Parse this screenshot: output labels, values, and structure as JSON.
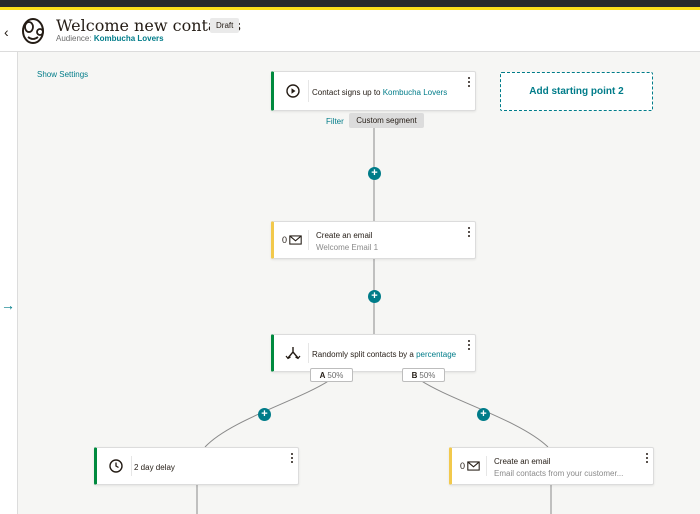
{
  "header": {
    "back_label": "‹",
    "title": "Welcome new contacts",
    "status_badge": "Draft",
    "audience_prefix": "Audience:",
    "audience_name": "Kombucha Lovers"
  },
  "sidebar": {
    "show_settings": "Show Settings",
    "expand_icon": "arrow-right-icon",
    "expand_glyph": "→"
  },
  "journey": {
    "trigger": {
      "icon": "play-icon",
      "text_prefix": "Contact signs up to",
      "text_link": "Kombucha Lovers"
    },
    "add_starting_point": "Add starting point 2",
    "filter_label": "Filter",
    "segment_label": "Custom segment",
    "email_step_1": {
      "icon": "envelope-icon",
      "count": "0",
      "title": "Create an email",
      "subtitle": "Welcome Email 1"
    },
    "split_step": {
      "icon": "split-icon",
      "text_prefix": "Randomly split contacts by a",
      "text_link": "percentage"
    },
    "branch_a": {
      "letter": "A",
      "percent": "50%"
    },
    "branch_b": {
      "letter": "B",
      "percent": "50%"
    },
    "delay_step": {
      "icon": "clock-icon",
      "title": "2 day delay"
    },
    "email_step_2": {
      "icon": "envelope-icon",
      "count": "0",
      "title": "Create an email",
      "subtitle": "Email contacts from your customer..."
    },
    "add_step_glyph": "+"
  },
  "colors": {
    "brand_teal": "#007c89",
    "status_green": "#008a3e",
    "email_yellow": "#f2c94c",
    "top_yellow": "#ffe01b"
  }
}
